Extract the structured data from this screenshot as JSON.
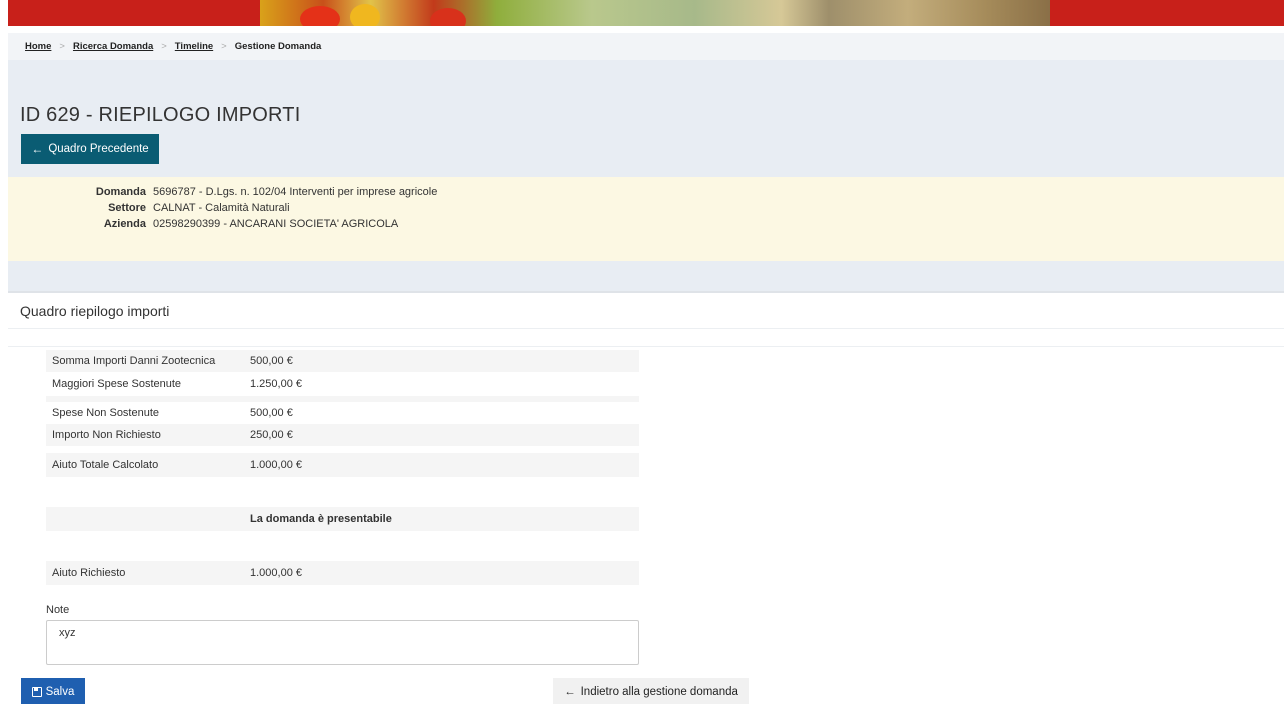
{
  "breadcrumb": {
    "items": [
      {
        "label": "Home"
      },
      {
        "label": "Ricerca Domanda"
      },
      {
        "label": "Timeline"
      }
    ],
    "current": "Gestione Domanda",
    "separator": ">"
  },
  "header": {
    "title": "ID 629 - RIEPILOGO IMPORTI",
    "back_label": "Quadro Precedente"
  },
  "info": {
    "domanda_label": "Domanda",
    "domanda_value": "5696787 - D.Lgs. n. 102/04 Interventi per imprese agricole",
    "settore_label": "Settore",
    "settore_value": "CALNAT - Calamità Naturali",
    "azienda_label": "Azienda",
    "azienda_value": "02598290399 - ANCARANI SOCIETA' AGRICOLA"
  },
  "panel": {
    "title": "Quadro riepilogo importi",
    "rows": [
      {
        "label": "Somma Importi Danni Zootecnica",
        "value": "500,00 €"
      },
      {
        "label": "Maggiori Spese Sostenute",
        "value": "1.250,00 €"
      },
      {
        "label": "Spese Non Sostenute",
        "value": "500,00 €"
      },
      {
        "label": "Importo Non Richiesto",
        "value": "250,00 €"
      },
      {
        "label": "Aiuto Totale Calcolato",
        "value": "1.000,00 €"
      }
    ],
    "status_message": "La domanda è presentabile",
    "aiuto_richiesto_label": "Aiuto Richiesto",
    "aiuto_richiesto_value": "1.000,00 €",
    "note_label": "Note",
    "note_value": "xyz"
  },
  "actions": {
    "save_label": "Salva",
    "back_label": "Indietro alla gestione domanda"
  },
  "colors": {
    "banner_red": "#c8201a",
    "primary_teal": "#0a5c73",
    "save_blue": "#1f5fb0",
    "info_bg": "#fcf8e3",
    "header_bg": "#e8edf3"
  },
  "icons": {
    "back_arrow": "arrow-left-icon",
    "save": "floppy-disk-icon"
  }
}
